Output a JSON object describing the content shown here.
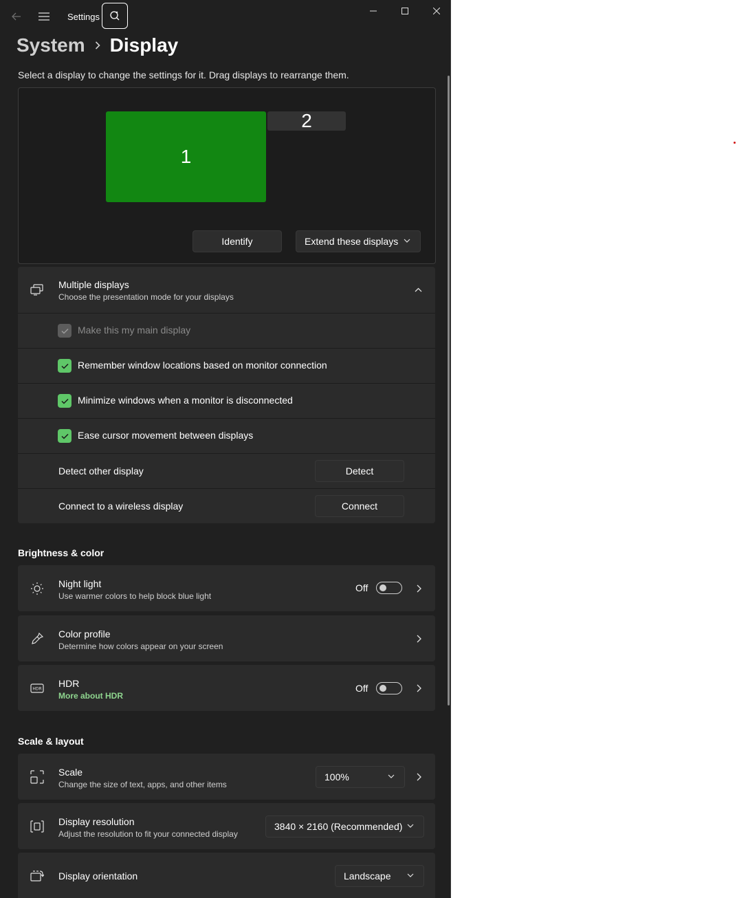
{
  "titlebar": {
    "app_title": "Settings"
  },
  "breadcrumb": {
    "parent": "System",
    "current": "Display"
  },
  "intro_text": "Select a display to change the settings for it. Drag displays to rearrange them.",
  "arrangement": {
    "monitors": [
      {
        "label": "1",
        "selected": true
      },
      {
        "label": "2",
        "selected": false
      }
    ],
    "identify_label": "Identify",
    "mode_select": "Extend these displays"
  },
  "multiple_displays": {
    "title": "Multiple displays",
    "subtitle": "Choose the presentation mode for your displays",
    "options": [
      {
        "label": "Make this my main display",
        "checked": true,
        "disabled": true
      },
      {
        "label": "Remember window locations based on monitor connection",
        "checked": true,
        "disabled": false
      },
      {
        "label": "Minimize windows when a monitor is disconnected",
        "checked": true,
        "disabled": false
      },
      {
        "label": "Ease cursor movement between displays",
        "checked": true,
        "disabled": false
      }
    ],
    "detect": {
      "label": "Detect other display",
      "button": "Detect"
    },
    "connect": {
      "label": "Connect to a wireless display",
      "button": "Connect"
    }
  },
  "brightness_color": {
    "heading": "Brightness & color",
    "night_light": {
      "title": "Night light",
      "subtitle": "Use warmer colors to help block blue light",
      "state": "Off"
    },
    "color_profile": {
      "title": "Color profile",
      "subtitle": "Determine how colors appear on your screen"
    },
    "hdr": {
      "title": "HDR",
      "link": "More about HDR",
      "state": "Off"
    }
  },
  "scale_layout": {
    "heading": "Scale & layout",
    "scale": {
      "title": "Scale",
      "subtitle": "Change the size of text, apps, and other items",
      "value": "100%"
    },
    "resolution": {
      "title": "Display resolution",
      "subtitle": "Adjust the resolution to fit your connected display",
      "value": "3840 × 2160 (Recommended)"
    },
    "orientation": {
      "title": "Display orientation",
      "value": "Landscape"
    }
  },
  "colors": {
    "accent": "#128712",
    "checkbox": "#5fc768",
    "link": "#8fd68f",
    "background": "#202020",
    "card": "#2b2b2b"
  }
}
